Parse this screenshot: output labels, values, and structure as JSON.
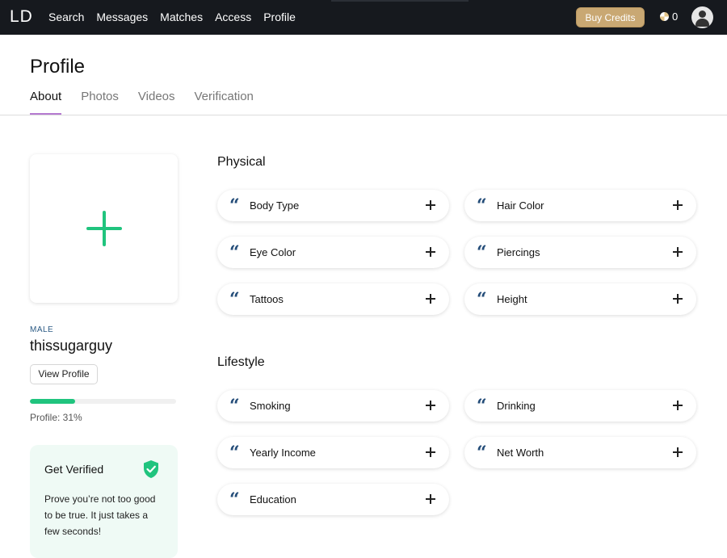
{
  "header": {
    "logo": "LD",
    "nav": [
      "Search",
      "Messages",
      "Matches",
      "Access",
      "Profile"
    ],
    "buy_credits": "Buy Credits",
    "credits": "0"
  },
  "page": {
    "title": "Profile",
    "tabs": [
      "About",
      "Photos",
      "Videos",
      "Verification"
    ],
    "active_tab": "About"
  },
  "profile": {
    "gender": "MALE",
    "username": "thissugarguy",
    "view_profile": "View Profile",
    "progress_percent": 31,
    "progress_text": "Profile: 31%"
  },
  "verify": {
    "title": "Get Verified",
    "text": "Prove you’re not too good to be true. It just takes a few seconds!",
    "accent": "#20c47e"
  },
  "sections": {
    "physical": {
      "title": "Physical",
      "fields": [
        "Body Type",
        "Hair Color",
        "Eye Color",
        "Piercings",
        "Tattoos",
        "Height"
      ]
    },
    "lifestyle": {
      "title": "Lifestyle",
      "fields": [
        "Smoking",
        "Drinking",
        "Yearly Income",
        "Net Worth",
        "Education"
      ]
    }
  },
  "colors": {
    "topbar": "#16191e",
    "gold": "#c9a873",
    "tab_underline": "#b57ad1",
    "quote": "#234c78"
  }
}
